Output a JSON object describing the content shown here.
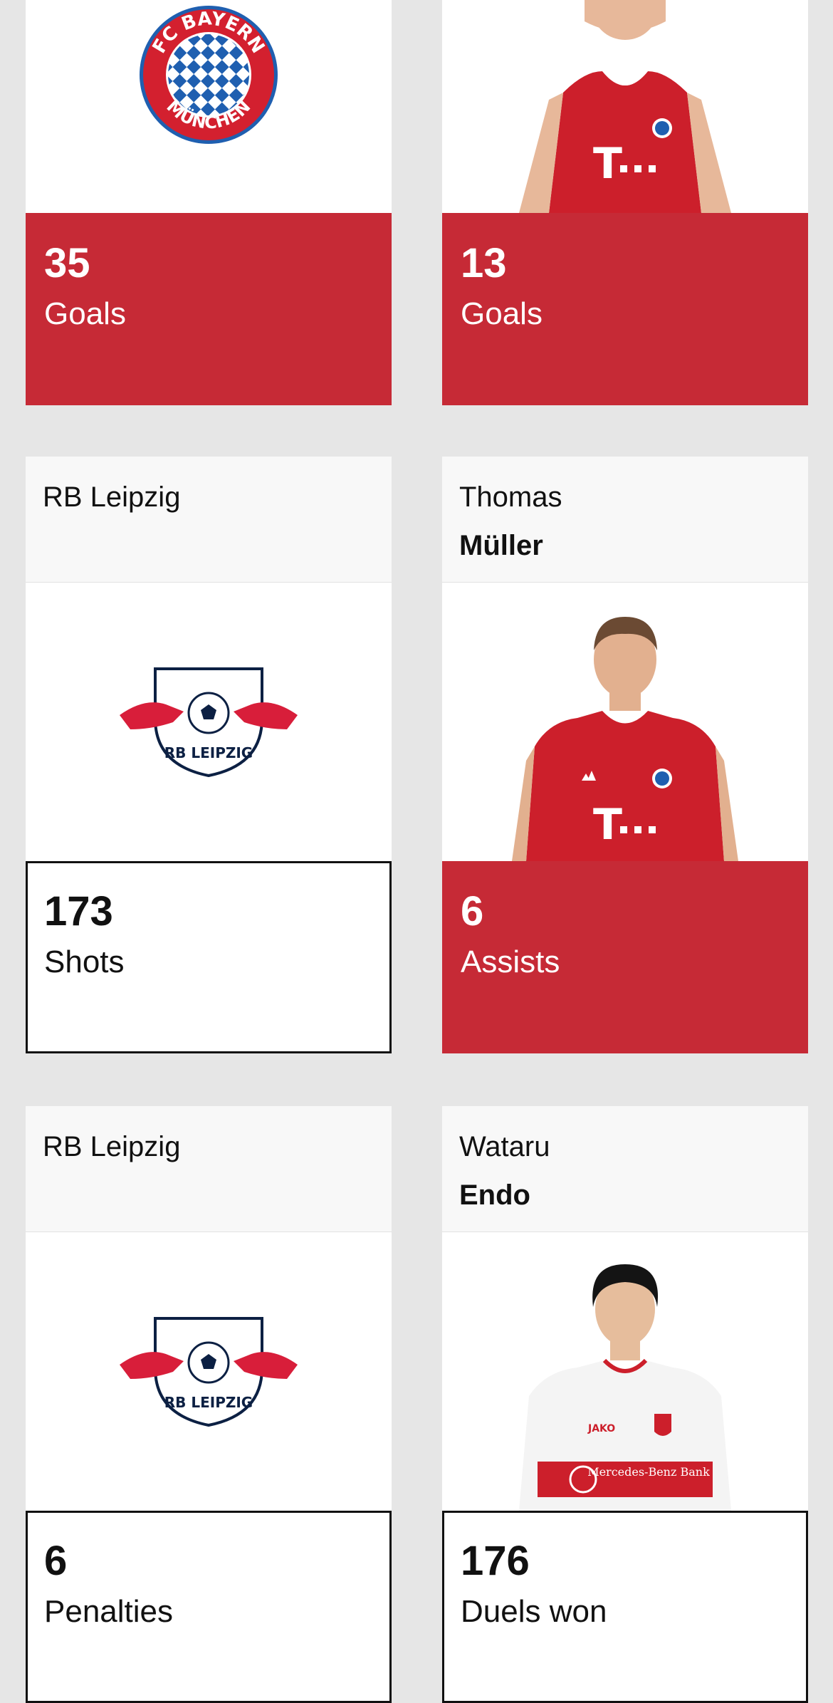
{
  "cards": {
    "c1": {
      "team": "FC Bayern München",
      "logo_text_top": "FC BAYERN",
      "logo_text_bottom": "MÜNCHEN",
      "stat_value": "35",
      "stat_label": "Goals"
    },
    "c2": {
      "stat_value": "13",
      "stat_label": "Goals"
    },
    "c3": {
      "team": "RB Leipzig",
      "logo_text": "RB LEIPZIG",
      "stat_value": "173",
      "stat_label": "Shots"
    },
    "c4": {
      "first_name": "Thomas",
      "last_name": "Müller",
      "stat_value": "6",
      "stat_label": "Assists"
    },
    "c5": {
      "team": "RB Leipzig",
      "logo_text": "RB LEIPZIG",
      "stat_value": "6",
      "stat_label": "Penalties"
    },
    "c6": {
      "first_name": "Wataru",
      "last_name": "Endo",
      "sponsor": "Mercedes-Benz Bank",
      "kit_brand": "JAKO",
      "stat_value": "176",
      "stat_label": "Duels won"
    }
  },
  "colors": {
    "bayern_red": "#c62a36",
    "page_bg": "#e6e6e6",
    "header_bg": "#f8f8f8"
  }
}
